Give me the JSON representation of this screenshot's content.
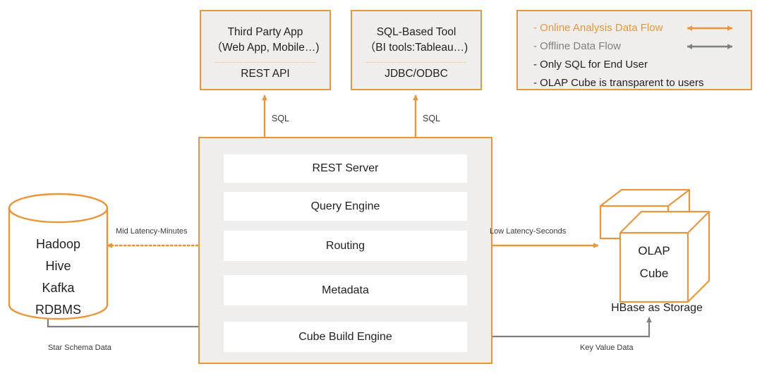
{
  "colors": {
    "orange": "#e8963c",
    "orange_light": "#f0b878",
    "gray": "#808080",
    "gray_arrow": "#7f7f7f",
    "panel_fill": "#efeeec",
    "text": "#231f20",
    "white": "#ffffff"
  },
  "clients": [
    {
      "title_line1": "Third Party App",
      "title_line2": "（Web App, Mobile…)",
      "protocol": "REST API",
      "arrow_label": "SQL"
    },
    {
      "title_line1": "SQL-Based Tool",
      "title_line2": "（BI tools:Tableau…)",
      "protocol": "JDBC/ODBC",
      "arrow_label": "SQL"
    }
  ],
  "legend": {
    "items": [
      {
        "label": "- Online Analysis Data Flow",
        "color": "#e8963c",
        "arrow": "bidirectional-orange"
      },
      {
        "label": "- Offline Data Flow",
        "color": "#808080",
        "arrow": "bidirectional-gray"
      },
      {
        "label": "- Only SQL for End User",
        "color": "#231f20",
        "arrow": "none"
      },
      {
        "label": "- OLAP Cube is transparent to users",
        "color": "#231f20",
        "arrow": "none"
      }
    ]
  },
  "core": {
    "layers": [
      {
        "label": "REST Server"
      },
      {
        "label": "Query Engine"
      },
      {
        "label": "Routing"
      },
      {
        "label": "Metadata"
      },
      {
        "label": "Cube Build Engine"
      }
    ]
  },
  "source": {
    "lines": [
      "Hadoop",
      "Hive",
      "Kafka",
      "RDBMS"
    ]
  },
  "storage": {
    "cube_line1": "OLAP",
    "cube_line2": "Cube",
    "caption": "HBase  as Storage"
  },
  "edges": {
    "mid_latency": "Mid Latency-Minutes",
    "low_latency": "Low Latency-Seconds",
    "star_schema": "Star Schema Data",
    "key_value": "Key Value Data"
  }
}
